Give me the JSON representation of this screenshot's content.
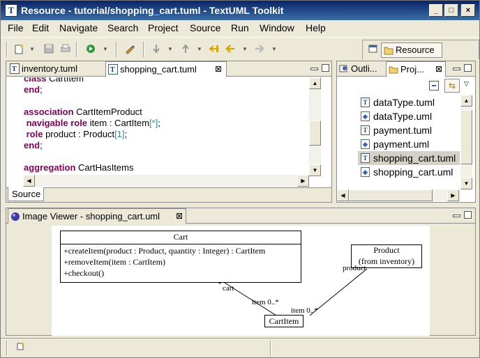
{
  "window": {
    "title": "Resource - tutorial/shopping_cart.tuml - TextUML Toolkit",
    "buttons": {
      "minimize": "_",
      "maximize": "□",
      "close": "×"
    }
  },
  "menu": [
    "File",
    "Edit",
    "Navigate",
    "Search",
    "Project",
    "Source",
    "Run",
    "Window",
    "Help"
  ],
  "toolbar": {
    "perspective_label": "Resource",
    "icons": [
      "new-icon",
      "save-icon",
      "print-icon",
      "run-icon",
      "pencil-icon",
      "next-annotation-icon",
      "prev-annotation-icon",
      "back-icon",
      "forward-icon"
    ]
  },
  "editor": {
    "tabs": [
      {
        "label": "inventory.tuml"
      },
      {
        "label": "shopping_cart.tuml"
      }
    ],
    "bottom_tab": "Source",
    "lines": [
      {
        "kw": "class",
        "rest": " CartItem"
      },
      {
        "kw": "end",
        "rest": ";"
      },
      {
        "kw": "association",
        "rest": " CartItemProduct"
      },
      {
        "kw": " navigable role",
        "rest": " item : CartItem",
        "mult": "[*]",
        "tail": ";"
      },
      {
        "kw": " role",
        "rest": " product : Product",
        "mult": "[1]",
        "tail": ";"
      },
      {
        "kw": "end",
        "rest": ";"
      },
      {
        "kw": "aggregation",
        "rest": " CartHasItems"
      }
    ]
  },
  "explorer": {
    "tabs": [
      {
        "label": "Outli..."
      },
      {
        "label": "Proj..."
      }
    ],
    "files": [
      {
        "name": "dataType.tuml",
        "kind": "tuml"
      },
      {
        "name": "dataType.uml",
        "kind": "uml"
      },
      {
        "name": "payment.tuml",
        "kind": "tuml"
      },
      {
        "name": "payment.uml",
        "kind": "uml"
      },
      {
        "name": "shopping_cart.tuml",
        "kind": "tuml",
        "selected": true
      },
      {
        "name": "shopping_cart.uml",
        "kind": "uml"
      }
    ]
  },
  "image_viewer": {
    "tab_label": "Image Viewer - shopping_cart.uml",
    "diagram": {
      "cart_class": {
        "name": "Cart",
        "operations": [
          "+createItem(product : Product, quantity : Integer) : CartItem",
          "+removeItem(item : CartItem)",
          "+checkout()"
        ]
      },
      "product_class": {
        "name": "Product",
        "subtitle": "(from inventory)"
      },
      "cartitem_class": {
        "name": "CartItem"
      },
      "labels": {
        "cart": "cart",
        "item_cart": "item 0..*",
        "item_product": "item 0..*",
        "product": "product"
      }
    }
  }
}
